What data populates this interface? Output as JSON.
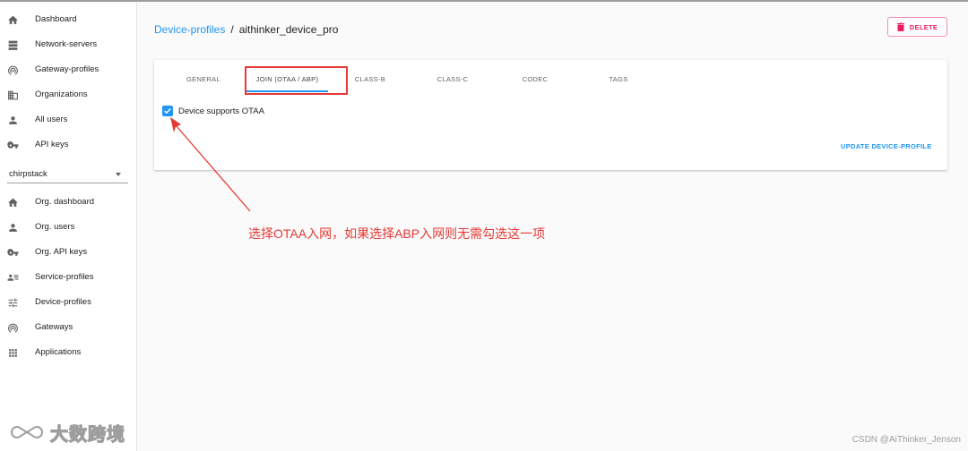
{
  "sidebar": {
    "global_items": [
      {
        "label": "Dashboard",
        "icon": "home-icon"
      },
      {
        "label": "Network-servers",
        "icon": "server-icon"
      },
      {
        "label": "Gateway-profiles",
        "icon": "antenna-icon"
      },
      {
        "label": "Organizations",
        "icon": "domain-icon"
      },
      {
        "label": "All users",
        "icon": "person-icon"
      },
      {
        "label": "API keys",
        "icon": "key-icon"
      }
    ],
    "org_select": {
      "value": "chirpstack"
    },
    "org_items": [
      {
        "label": "Org. dashboard",
        "icon": "home-icon"
      },
      {
        "label": "Org. users",
        "icon": "person-icon"
      },
      {
        "label": "Org. API keys",
        "icon": "key-icon"
      },
      {
        "label": "Service-profiles",
        "icon": "account-details-icon"
      },
      {
        "label": "Device-profiles",
        "icon": "tune-icon"
      },
      {
        "label": "Gateways",
        "icon": "antenna-icon"
      },
      {
        "label": "Applications",
        "icon": "apps-grid-icon"
      }
    ]
  },
  "header": {
    "breadcrumb_link": "Device-profiles",
    "breadcrumb_sep": "/",
    "breadcrumb_current": "aithinker_device_pro",
    "delete_label": "DELETE"
  },
  "tabs": [
    {
      "label": "GENERAL",
      "active": false
    },
    {
      "label": "JOIN (OTAA / ABP)",
      "active": true
    },
    {
      "label": "CLASS-B",
      "active": false
    },
    {
      "label": "CLASS-C",
      "active": false
    },
    {
      "label": "CODEC",
      "active": false
    },
    {
      "label": "TAGS",
      "active": false
    }
  ],
  "form": {
    "supports_otaa_label": "Device supports OTAA",
    "supports_otaa_checked": true,
    "update_label": "UPDATE DEVICE-PROFILE"
  },
  "annotation": {
    "text": "选择OTAA入网，如果选择ABP入网则无需勾选这一项"
  },
  "watermarks": {
    "logo_text": "大数跨境",
    "csdn": "CSDN @AiThinker_Jenson"
  },
  "colors": {
    "accent": "#2196f3",
    "delete": "#e91e63",
    "annotation": "#e53935"
  }
}
